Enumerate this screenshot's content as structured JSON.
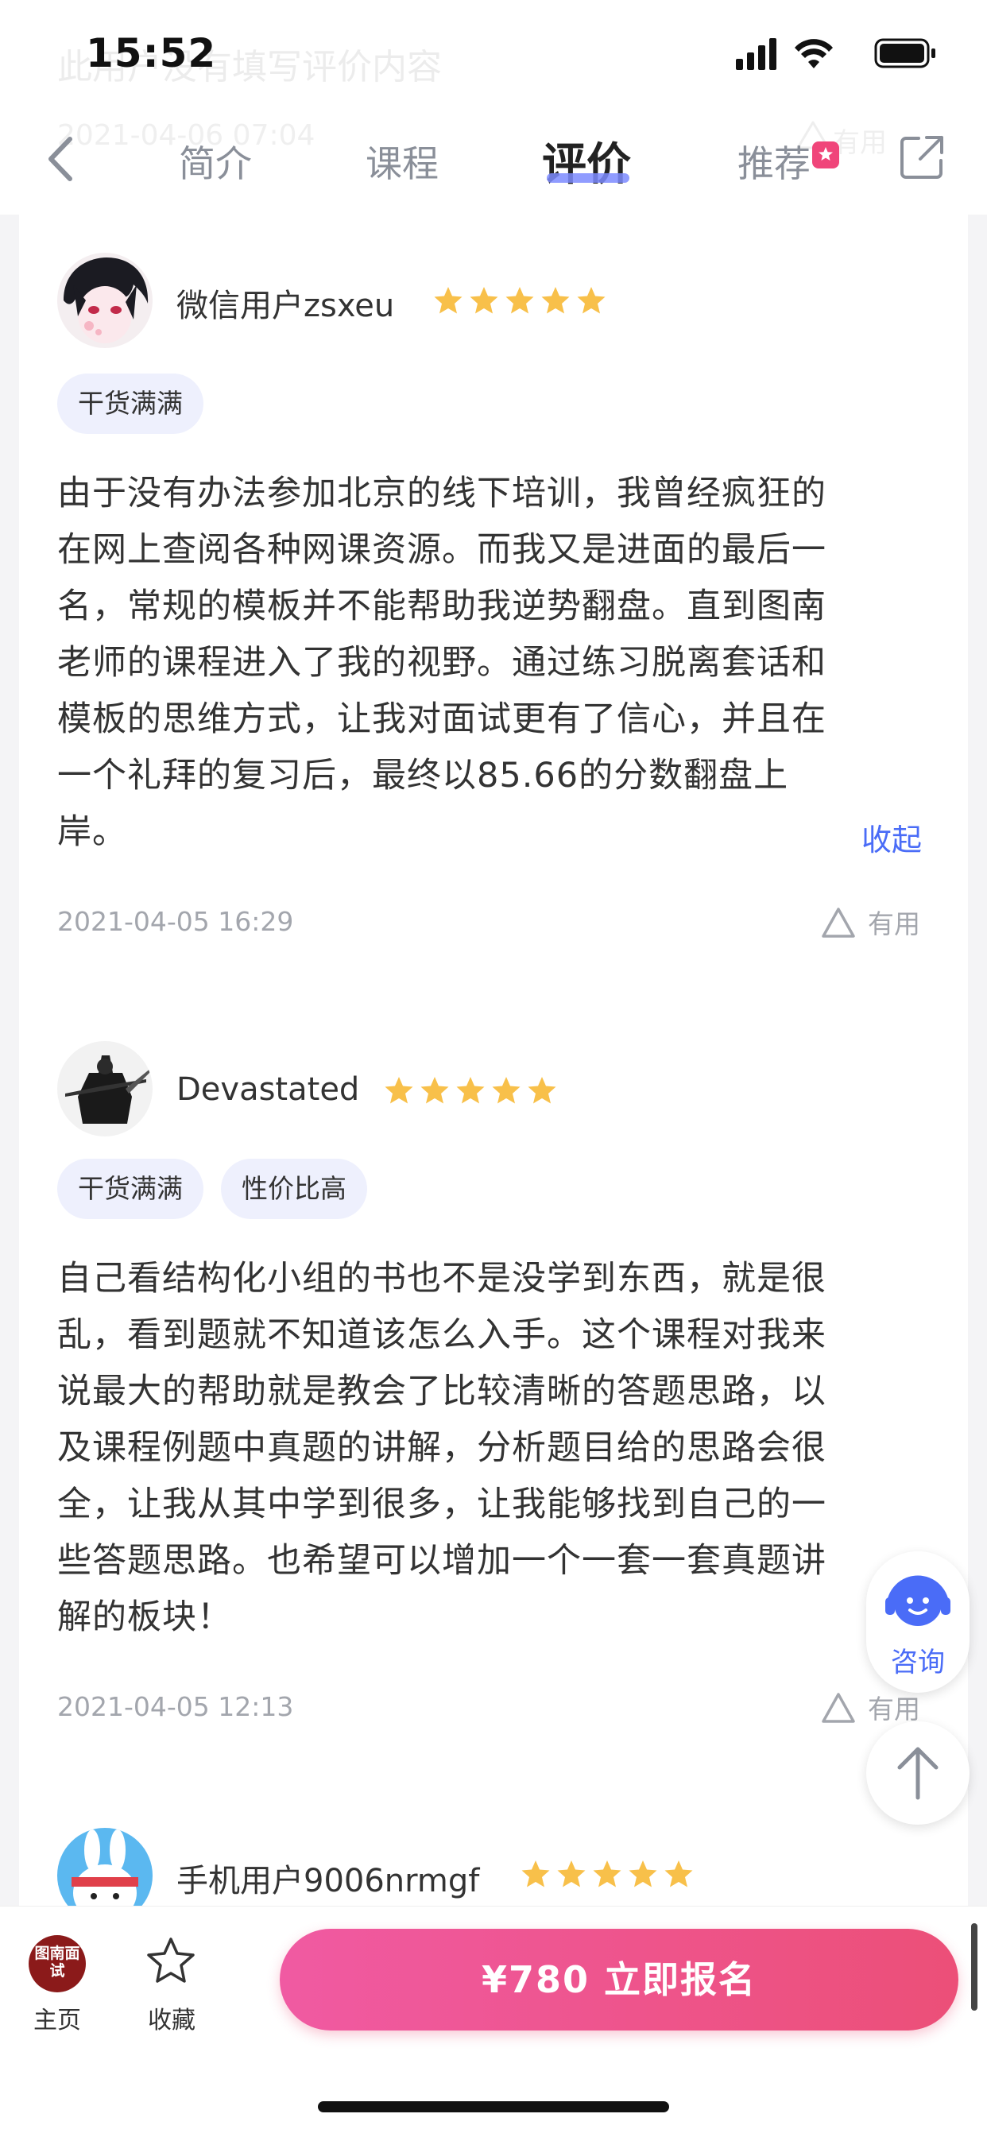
{
  "status_bar": {
    "time": "15:52"
  },
  "ghost_header": {
    "text": "此用户没有填写评价内容",
    "date": "2021-04-06 07:04",
    "useful": "有用"
  },
  "nav": {
    "tabs": [
      {
        "label": "简介"
      },
      {
        "label": "课程"
      },
      {
        "label": "评价"
      },
      {
        "label": "推荐"
      }
    ],
    "active_tab": "评价",
    "accent_color": "#7d8bff"
  },
  "reviews": [
    {
      "username": "微信用户zsxeu",
      "rating": 5,
      "tags": [
        "干货满满"
      ],
      "text_lines": [
        "由于没有办法参加北京的线下培训，我曾经疯狂的",
        "在网上查阅各种网课资源。而我又是进面的最后一",
        "名，常规的模板并不能帮助我逆势翻盘。直到图南",
        "老师的课程进入了我的视野。通过练习脱离套话和",
        "模板的思维方式，让我对面试更有了信心，并且在",
        "一个礼拜的复习后，最终以85.66的分数翻盘上",
        "岸。"
      ],
      "collapse_label": "收起",
      "date": "2021-04-05 16:29",
      "useful_label": "有用"
    },
    {
      "username": "Devastated",
      "rating": 5,
      "tags": [
        "干货满满",
        "性价比高"
      ],
      "text_lines": [
        "自己看结构化小组的书也不是没学到东西，就是很",
        "乱，看到题就不知道该怎么入手。这个课程对我来",
        "说最大的帮助就是教会了比较清晰的答题思路，以",
        "及课程例题中真题的讲解，分析题目给的思路会很",
        "全，让我从其中学到很多，让我能够找到自己的一",
        "些答题思路。也希望可以增加一个一套一套真题讲",
        "解的板块！"
      ],
      "date": "2021-04-05 12:13",
      "useful_label": "有用"
    },
    {
      "username": "手机用户9006nrmgf",
      "rating": 5
    }
  ],
  "floating": {
    "consult_label": "咨询"
  },
  "bottom_bar": {
    "logo_text": "图南面试",
    "home_label": "主页",
    "favorite_label": "收藏",
    "enroll_label": "¥780  立即报名",
    "enroll_colors": [
      "#f05aa2",
      "#ec4f78"
    ]
  },
  "colors": {
    "star": "#f8c04a",
    "link": "#4a6cf7",
    "tag_bg": "#eef0fd"
  }
}
